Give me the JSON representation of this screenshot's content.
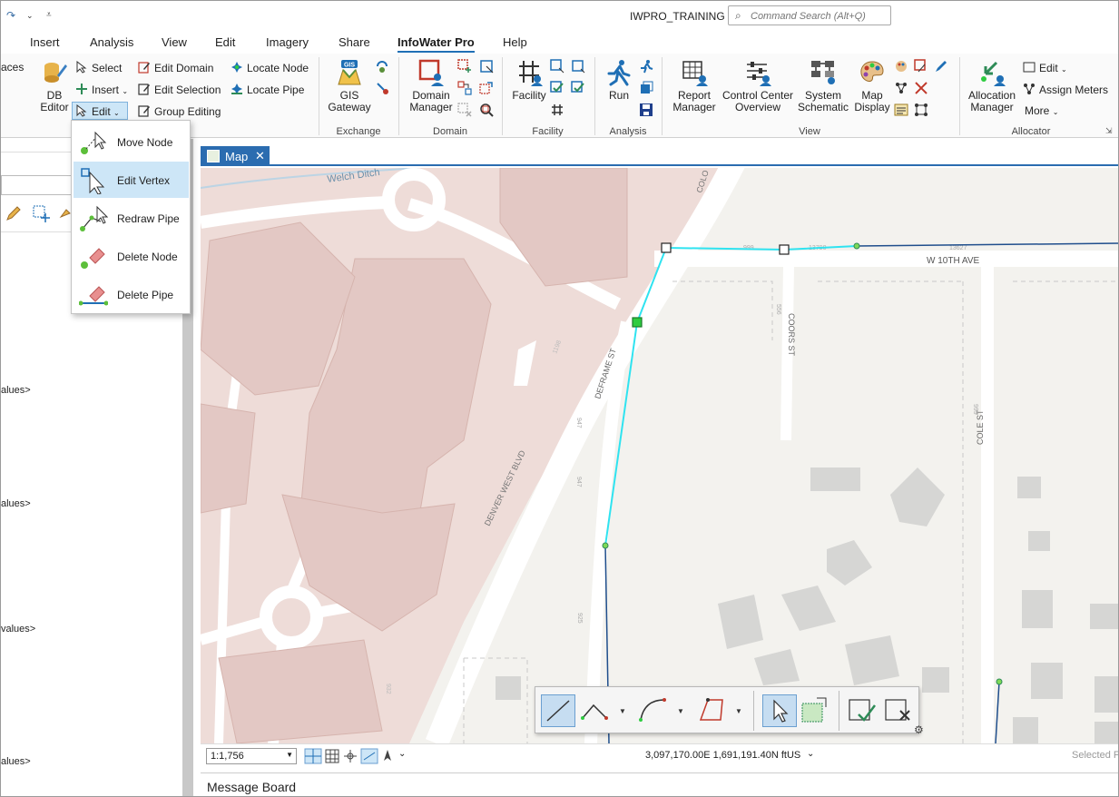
{
  "title_bar": {
    "app_title": "IWPRO_TRAINING",
    "search_placeholder": "Command Search (Alt+Q)"
  },
  "ribbon_tabs": [
    "Insert",
    "Analysis",
    "View",
    "Edit",
    "Imagery",
    "Share",
    "InfoWater Pro",
    "Help"
  ],
  "active_tab": "InfoWater Pro",
  "ribbon": {
    "left_cut_text": "aces",
    "db_editor": "DB\nEditor",
    "db_editor_l1": "DB",
    "db_editor_l2": "Editor",
    "select": "Select",
    "insert": "Insert",
    "edit": "Edit",
    "edit_domain": "Edit Domain",
    "edit_selection": "Edit Selection",
    "group_editing": "Group Editing",
    "locate_node": "Locate Node",
    "locate_pipe": "Locate Pipe",
    "gis_gateway_l1": "GIS",
    "gis_gateway_l2": "Gateway",
    "gis_badge": "GIS",
    "domain_manager_l1": "Domain",
    "domain_manager_l2": "Manager",
    "facility": "Facility",
    "run": "Run",
    "report_manager_l1": "Report",
    "report_manager_l2": "Manager",
    "control_center_l1": "Control Center",
    "control_center_l2": "Overview",
    "system_schematic_l1": "System",
    "system_schematic_l2": "Schematic",
    "map_display_l1": "Map",
    "map_display_l2": "Display",
    "allocation_manager_l1": "Allocation",
    "allocation_manager_l2": "Manager",
    "alloc_edit": "Edit",
    "assign_meters": "Assign Meters",
    "more": "More",
    "groups": {
      "exchange": "Exchange",
      "domain": "Domain",
      "facility": "Facility",
      "analysis": "Analysis",
      "view": "View",
      "allocator": "Allocator"
    }
  },
  "edit_menu": {
    "items": [
      "Move Node",
      "Edit Vertex",
      "Redraw Pipe",
      "Delete Node",
      "Delete Pipe"
    ],
    "highlighted": "Edit Vertex"
  },
  "left_panel": {
    "values_label": "values>",
    "values_label_1": "alues>",
    "values_label_2": "alues>",
    "values_label_3": "values>",
    "values_label_4": "alues>"
  },
  "map_tab": {
    "label": "Map"
  },
  "map_labels": {
    "welch_ditch": "Welch Ditch",
    "w_10th_ave": "W 10TH AVE",
    "coors_st": "COORS ST",
    "deframe_st": "DEFRAME ST",
    "denver_west_blvd": "DENVER WEST BLVD",
    "cole_st": "COLE ST",
    "colo_partial": "COLO",
    "addr_999": "999",
    "addr_13790": "13790",
    "addr_13627": "13627",
    "addr_556": "556",
    "addr_1198": "1198",
    "addr_947": "947",
    "addr_947b": "947",
    "addr_999b": "999",
    "addr_925": "925",
    "addr_932": "932"
  },
  "status_bar": {
    "scale": "1:1,756",
    "coordinates": "3,097,170.00E 1,691,191.40N ftUS",
    "selected": "Selected F"
  },
  "message_board": {
    "label": "Message Board"
  },
  "colors": {
    "accent": "#2b6cb0",
    "selected_pipe": "#2fe3f0",
    "pipe": "#1f4e8c",
    "building": "#e3c8c4",
    "node_green": "#2ecc40"
  }
}
